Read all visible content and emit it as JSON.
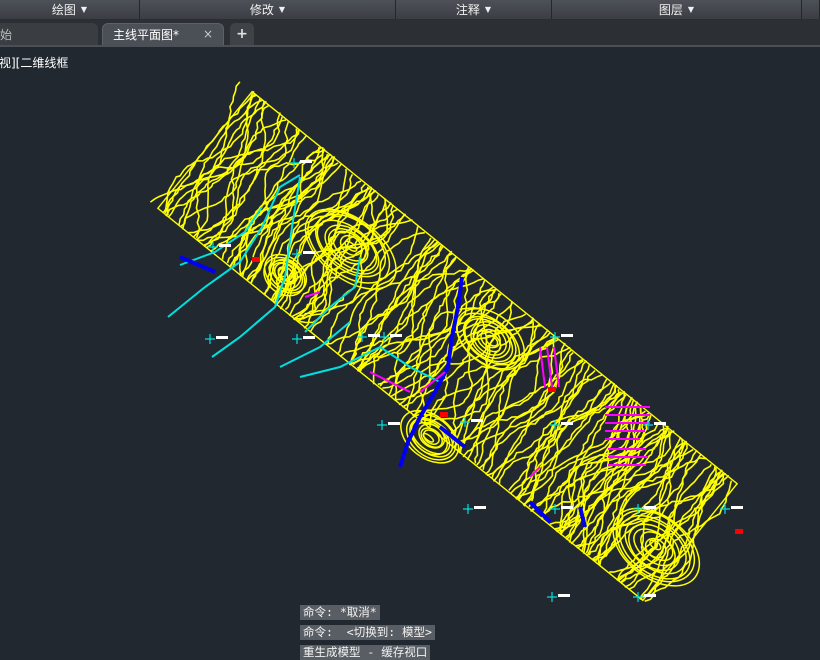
{
  "ribbon": {
    "panels": [
      {
        "label": "绘图",
        "caret": "▼"
      },
      {
        "label": "修改",
        "caret": "▼"
      },
      {
        "label": "注释",
        "caret": "▼"
      },
      {
        "label": "图层",
        "caret": "▼"
      }
    ]
  },
  "tabs": {
    "start_label": "始",
    "active_label": "主线平面图*",
    "close_glyph": "×",
    "new_glyph": "+"
  },
  "viewport": {
    "label": "视][二维线框"
  },
  "command_history": [
    "命令: *取消*",
    "命令:  <切换到: 模型>",
    "重生成模型 - 缓存视口"
  ],
  "colors": {
    "background": "#212830",
    "contour": "#ffff00",
    "stream": "#00e0e0",
    "road": "#0000ee",
    "annotation": "#ff00ff",
    "marker": "#ff0000",
    "label": "#ffffff"
  },
  "icons": {
    "caret": "caret-down-icon",
    "close": "close-icon",
    "new_tab": "plus-icon"
  }
}
